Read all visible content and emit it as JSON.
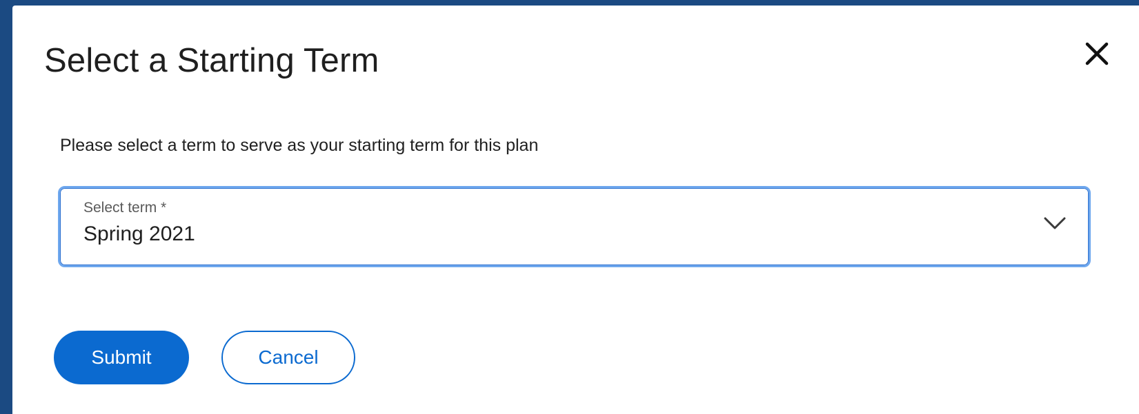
{
  "dialog": {
    "title": "Select a Starting Term",
    "instructions": "Please select a term to serve as your starting term for this plan",
    "close_icon": "close-icon"
  },
  "term_select": {
    "label": "Select term *",
    "value": "Spring 2021",
    "icon": "chevron-down-icon"
  },
  "actions": {
    "submit_label": "Submit",
    "cancel_label": "Cancel"
  },
  "colors": {
    "backdrop": "#1b4a82",
    "primary": "#0b6ad0",
    "focus_border": "#6fa8ee"
  }
}
